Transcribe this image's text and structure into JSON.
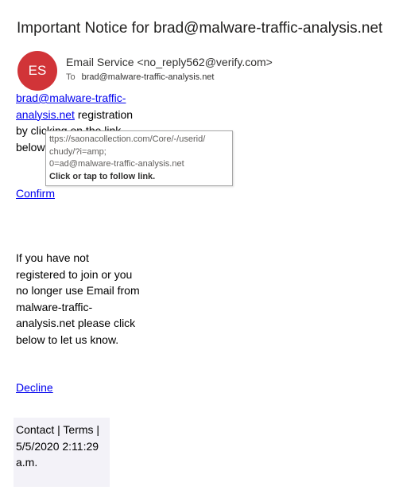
{
  "email": {
    "subject": "Important Notice for brad@malware-traffic-analysis.net",
    "avatar_initials": "ES",
    "avatar_color": "#d13438",
    "sender": "Email Service <no_reply562@verify.com>",
    "to_label": "To",
    "to_address": "brad@malware-traffic-analysis.net"
  },
  "body": {
    "link_line1": "brad@malware-traffic-",
    "link_line2": "analysis.net",
    "after_link": " registration",
    "line3": "by clicking on the link",
    "line4": "below",
    "confirm_label": "Confirm",
    "para2_lines": [
      "If you have not",
      "registered to join or you",
      "no longer use Email from",
      "malware-traffic-",
      "analysis.net please click",
      "below  to let us know."
    ],
    "decline_label": "Decline"
  },
  "tooltip": {
    "url_lines": [
      "ttps://saonacollection.com/Core/-/userid/",
      "chudy/?i=amp;",
      "0=ad@malware-traffic-analysis.net"
    ],
    "hint": "Click or tap to follow link."
  },
  "footer": {
    "links_text": "Contact | Terms |",
    "timestamp_line1": "5/5/2020 2:11:29",
    "timestamp_line2": "a.m."
  }
}
